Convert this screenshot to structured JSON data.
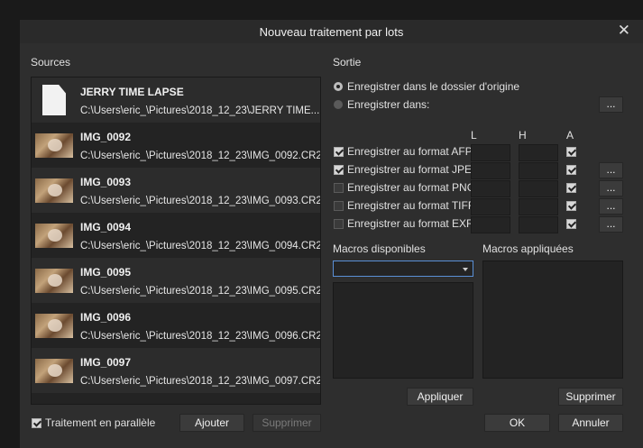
{
  "dialog": {
    "title": "Nouveau traitement par lots"
  },
  "sources": {
    "heading": "Sources",
    "items": [
      {
        "name": "JERRY TIME LAPSE",
        "path": "C:\\Users\\eric_\\Pictures\\2018_12_23\\JERRY TIME...",
        "icon": "document-icon"
      },
      {
        "name": "IMG_0092",
        "path": "C:\\Users\\eric_\\Pictures\\2018_12_23\\IMG_0092.CR2",
        "icon": "photo-thumbnail"
      },
      {
        "name": "IMG_0093",
        "path": "C:\\Users\\eric_\\Pictures\\2018_12_23\\IMG_0093.CR2",
        "icon": "photo-thumbnail"
      },
      {
        "name": "IMG_0094",
        "path": "C:\\Users\\eric_\\Pictures\\2018_12_23\\IMG_0094.CR2",
        "icon": "photo-thumbnail"
      },
      {
        "name": "IMG_0095",
        "path": "C:\\Users\\eric_\\Pictures\\2018_12_23\\IMG_0095.CR2",
        "icon": "photo-thumbnail"
      },
      {
        "name": "IMG_0096",
        "path": "C:\\Users\\eric_\\Pictures\\2018_12_23\\IMG_0096.CR2",
        "icon": "photo-thumbnail"
      },
      {
        "name": "IMG_0097",
        "path": "C:\\Users\\eric_\\Pictures\\2018_12_23\\IMG_0097.CR2",
        "icon": "photo-thumbnail"
      }
    ],
    "parallel_label": "Traitement en parallèle",
    "parallel_checked": true,
    "add_label": "Ajouter",
    "remove_label": "Supprimer"
  },
  "output": {
    "heading": "Sortie",
    "save_origin_label": "Enregistrer dans le dossier d'origine",
    "save_in_label": "Enregistrer dans:",
    "browse_label": "...",
    "col_w": "L",
    "col_h": "H",
    "col_a": "A",
    "formats": [
      {
        "label": "Enregistrer au format AFPhoto",
        "checked": true,
        "a_checked": true,
        "has_more": false
      },
      {
        "label": "Enregistrer au format JPEG",
        "checked": true,
        "a_checked": true,
        "has_more": true
      },
      {
        "label": "Enregistrer au format PNG",
        "checked": false,
        "a_checked": true,
        "has_more": true
      },
      {
        "label": "Enregistrer au format TIFF",
        "checked": false,
        "a_checked": true,
        "has_more": true
      },
      {
        "label": "Enregistrer au format EXR",
        "checked": false,
        "a_checked": true,
        "has_more": true
      }
    ],
    "more_label": "..."
  },
  "macros": {
    "available_heading": "Macros disponibles",
    "applied_heading": "Macros appliquées",
    "apply_label": "Appliquer",
    "remove_label": "Supprimer"
  },
  "footer": {
    "ok_label": "OK",
    "cancel_label": "Annuler"
  }
}
